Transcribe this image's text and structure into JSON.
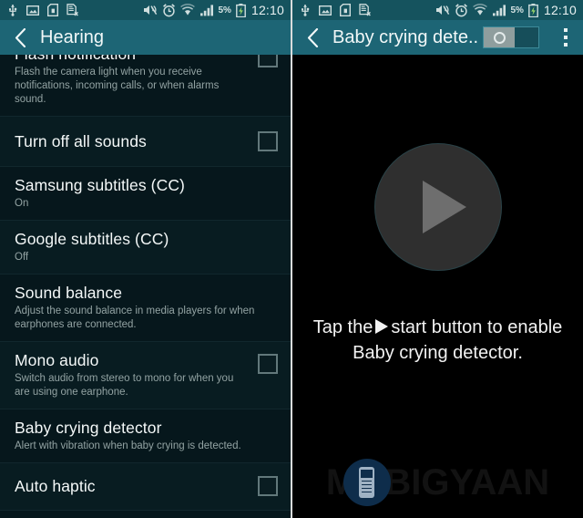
{
  "status_bar": {
    "icons_left": [
      "usb-icon",
      "image-icon",
      "sd-card-icon",
      "document-error-icon"
    ],
    "icons_right": [
      "mute-vibrate-icon",
      "alarm-icon",
      "wifi-icon",
      "signal-icon"
    ],
    "battery_percent": "5%",
    "clock": "12:10"
  },
  "left_panel": {
    "action_bar": {
      "back_icon": "back-chevron-icon",
      "title": "Hearing"
    },
    "items": [
      {
        "title": "Flash notification",
        "subtitle": "Flash the camera light when you receive notifications, incoming calls, or when alarms sound.",
        "checkbox": true,
        "checked": false,
        "clipped": true
      },
      {
        "title": "Turn off all sounds",
        "subtitle": "",
        "checkbox": true,
        "checked": false,
        "clipped": false
      },
      {
        "title": "Samsung subtitles (CC)",
        "subtitle": "On",
        "checkbox": false,
        "checked": false,
        "clipped": false
      },
      {
        "title": "Google subtitles (CC)",
        "subtitle": "Off",
        "checkbox": false,
        "checked": false,
        "clipped": false
      },
      {
        "title": "Sound balance",
        "subtitle": "Adjust the sound balance in media players for when earphones are connected.",
        "checkbox": false,
        "checked": false,
        "clipped": false
      },
      {
        "title": "Mono audio",
        "subtitle": "Switch audio from stereo to mono for when you are using one earphone.",
        "checkbox": true,
        "checked": false,
        "clipped": false
      },
      {
        "title": "Baby crying detector",
        "subtitle": "Alert with vibration when baby crying is detected.",
        "checkbox": false,
        "checked": false,
        "clipped": false
      },
      {
        "title": "Auto haptic",
        "subtitle": "",
        "checkbox": true,
        "checked": false,
        "clipped": false
      }
    ]
  },
  "right_panel": {
    "action_bar": {
      "back_icon": "back-chevron-icon",
      "title": "Baby crying dete..",
      "toggle_state": "off",
      "menu_icon": "overflow-menu-icon"
    },
    "play_button_icon": "play-icon",
    "hint_before": "Tap the",
    "hint_icon": "play-triangle-icon",
    "hint_after": "start button to enable Baby crying detector.",
    "watermark": "MOBIGYAAN"
  },
  "colors": {
    "status_bar": "#15535e",
    "action_bar": "#1d6575",
    "list_background": "#06171c",
    "right_background": "#000000",
    "divider": "#d9dcdc",
    "watermark_badge": "#0e2d4b"
  }
}
